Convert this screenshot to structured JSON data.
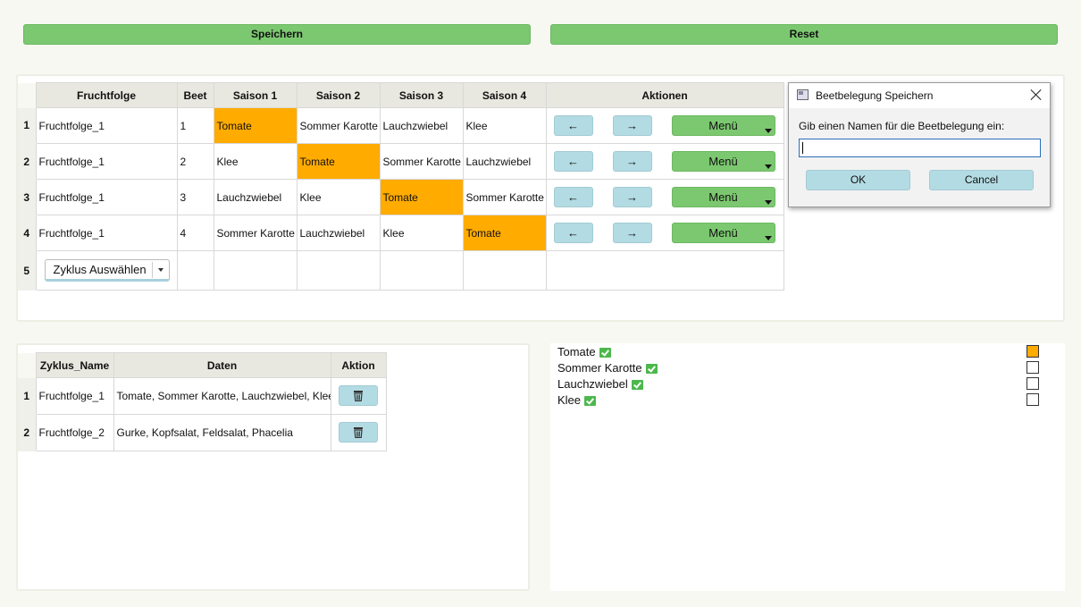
{
  "toolbar": {
    "save_label": "Speichern",
    "reset_label": "Reset"
  },
  "plan_table": {
    "headers": [
      "Fruchtfolge",
      "Beet",
      "Saison 1",
      "Saison 2",
      "Saison 3",
      "Saison 4",
      "Aktionen"
    ],
    "rows": [
      {
        "num": "1",
        "fruchtfolge": "Fruchtfolge_1",
        "beet": "1",
        "s1": "Tomate",
        "s2": "Sommer Karotte",
        "s3": "Lauchzwiebel",
        "s4": "Klee"
      },
      {
        "num": "2",
        "fruchtfolge": "Fruchtfolge_1",
        "beet": "2",
        "s1": "Klee",
        "s2": "Tomate",
        "s3": "Sommer Karotte",
        "s4": "Lauchzwiebel"
      },
      {
        "num": "3",
        "fruchtfolge": "Fruchtfolge_1",
        "beet": "3",
        "s1": "Lauchzwiebel",
        "s2": "Klee",
        "s3": "Tomate",
        "s4": "Sommer Karotte"
      },
      {
        "num": "4",
        "fruchtfolge": "Fruchtfolge_1",
        "beet": "4",
        "s1": "Sommer Karotte",
        "s2": "Lauchzwiebel",
        "s3": "Klee",
        "s4": "Tomate"
      }
    ],
    "row5_num": "5",
    "cycle_select": "Zyklus Auswählen",
    "btn_left": "←",
    "btn_right": "→",
    "btn_menu": "Menü",
    "highlight_color": "#ffab00"
  },
  "cycle_table": {
    "headers": [
      "Zyklus_Name",
      "Daten",
      "Aktion"
    ],
    "rows": [
      {
        "num": "1",
        "name": "Fruchtfolge_1",
        "daten": "Tomate, Sommer Karotte, Lauchzwiebel, Klee",
        "action_icon": "trash-icon"
      },
      {
        "num": "2",
        "name": "Fruchtfolge_2",
        "daten": "Gurke, Kopfsalat, Feldsalat, Phacelia",
        "action_icon": "trash-icon"
      }
    ]
  },
  "legend": {
    "items": [
      {
        "label": "Tomate",
        "checked": true,
        "selected": true
      },
      {
        "label": "Sommer Karotte",
        "checked": true,
        "selected": false
      },
      {
        "label": "Lauchzwiebel",
        "checked": true,
        "selected": false
      },
      {
        "label": "Klee",
        "checked": true,
        "selected": false
      }
    ],
    "selected_color": "#ffab00"
  },
  "dialog": {
    "title": "Beetbelegung Speichern",
    "prompt": "Gib einen Namen für die Beetbelegung ein:",
    "input_value": "",
    "ok_label": "OK",
    "cancel_label": "Cancel"
  }
}
